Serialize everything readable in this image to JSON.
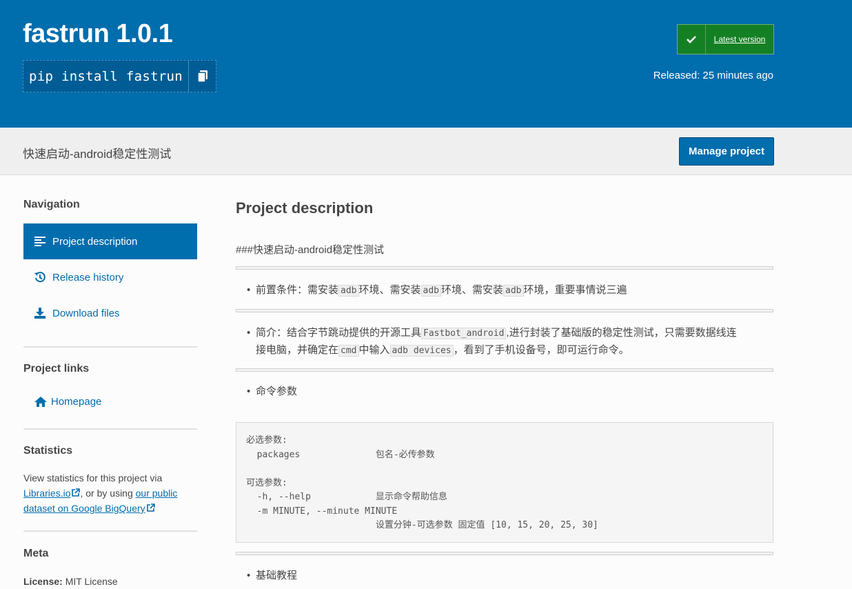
{
  "header": {
    "title": "fastrun 1.0.1",
    "pip_command": "pip install fastrun",
    "latest_label": "Latest version",
    "released": "Released: 25 minutes ago"
  },
  "subheader": {
    "summary": "快速启动-android稳定性测试",
    "manage_label": "Manage project"
  },
  "sidebar": {
    "navigation_heading": "Navigation",
    "nav_items": [
      {
        "label": "Project description",
        "icon": "align-left-icon",
        "active": true
      },
      {
        "label": "Release history",
        "icon": "history-icon"
      },
      {
        "label": "Download files",
        "icon": "download-icon"
      }
    ],
    "links_heading": "Project links",
    "homepage_label": "Homepage",
    "statistics_heading": "Statistics",
    "stats_text_1": "View statistics for this project via",
    "stats_link_1": "Libraries.io",
    "stats_text_2": ", or by using",
    "stats_link_2a": "our public",
    "stats_link_2b": "dataset on Google BigQuery",
    "meta_heading": "Meta",
    "license_label": "License:",
    "license_value": "MIT License"
  },
  "main": {
    "heading": "Project description",
    "intro": "###快速启动-android稳定性测试",
    "b1": {
      "t1": "前置条件：需安装",
      "c1": "adb",
      "t2": "环境、需安装",
      "c2": "adb",
      "t3": "环境、需安装",
      "c3": "adb",
      "t4": "环境，重要事情说三遍"
    },
    "b2": {
      "t1": "简介：结合字节跳动提供的开源工具",
      "c1": "Fastbot_android",
      "t2": ",进行封装了基础版的稳定性测试，只需要数据线连",
      "t3": "接电脑，并确定在",
      "c2": "cmd",
      "t4": "中输入",
      "c3": "adb devices",
      "t5": "，看到了手机设备号，即可运行命令。"
    },
    "b3": "命令参数",
    "code_lines": [
      "必选参数:",
      "  packages              包名-必传参数",
      "",
      "可选参数:",
      "  -h, --help            显示命令帮助信息",
      "  -m MINUTE, --minute MINUTE",
      "                        设置分钟-可选参数 固定值 [10, 15, 20, 25, 30]"
    ],
    "b4": "基础教程"
  }
}
